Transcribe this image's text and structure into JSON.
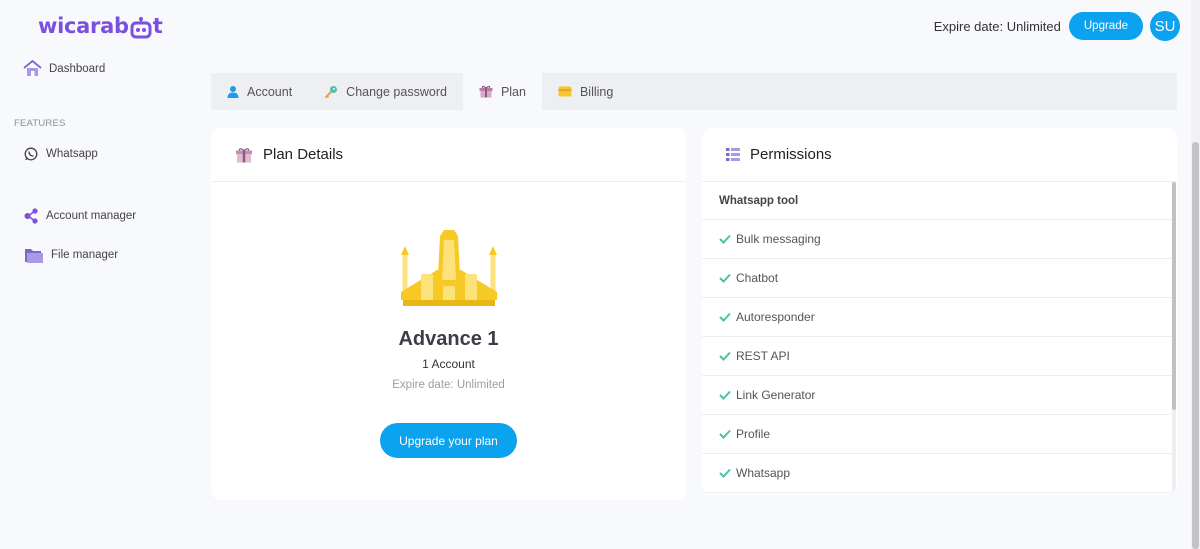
{
  "logo": {
    "text_left": "wicarab",
    "text_right": "t"
  },
  "header": {
    "expire_text": "Expire date: Unlimited",
    "upgrade_label": "Upgrade",
    "avatar_initials": "SU"
  },
  "sidebar": {
    "dashboard": "Dashboard",
    "section_features": "FEATURES",
    "whatsapp": "Whatsapp",
    "account_manager": "Account manager",
    "file_manager": "File manager"
  },
  "tabs": [
    {
      "label": "Account",
      "icon": "user-icon"
    },
    {
      "label": "Change password",
      "icon": "key-icon"
    },
    {
      "label": "Plan",
      "icon": "gift-icon"
    },
    {
      "label": "Billing",
      "icon": "credit-card-icon"
    }
  ],
  "active_tab": "Plan",
  "plan": {
    "card_title": "Plan Details",
    "name": "Advance 1",
    "accounts": "1 Account",
    "expire": "Expire date: Unlimited",
    "button_label": "Upgrade your plan"
  },
  "permissions": {
    "card_title": "Permissions",
    "group": "Whatsapp tool",
    "items": [
      "Bulk messaging",
      "Chatbot",
      "Autoresponder",
      "REST API",
      "Link Generator",
      "Profile",
      "Whatsapp"
    ]
  },
  "colors": {
    "brand_purple": "#7b4fe0",
    "accent_blue": "#0ba2ef",
    "check_green": "#4fbfa8",
    "rocket_yellow": "#f6c927"
  }
}
